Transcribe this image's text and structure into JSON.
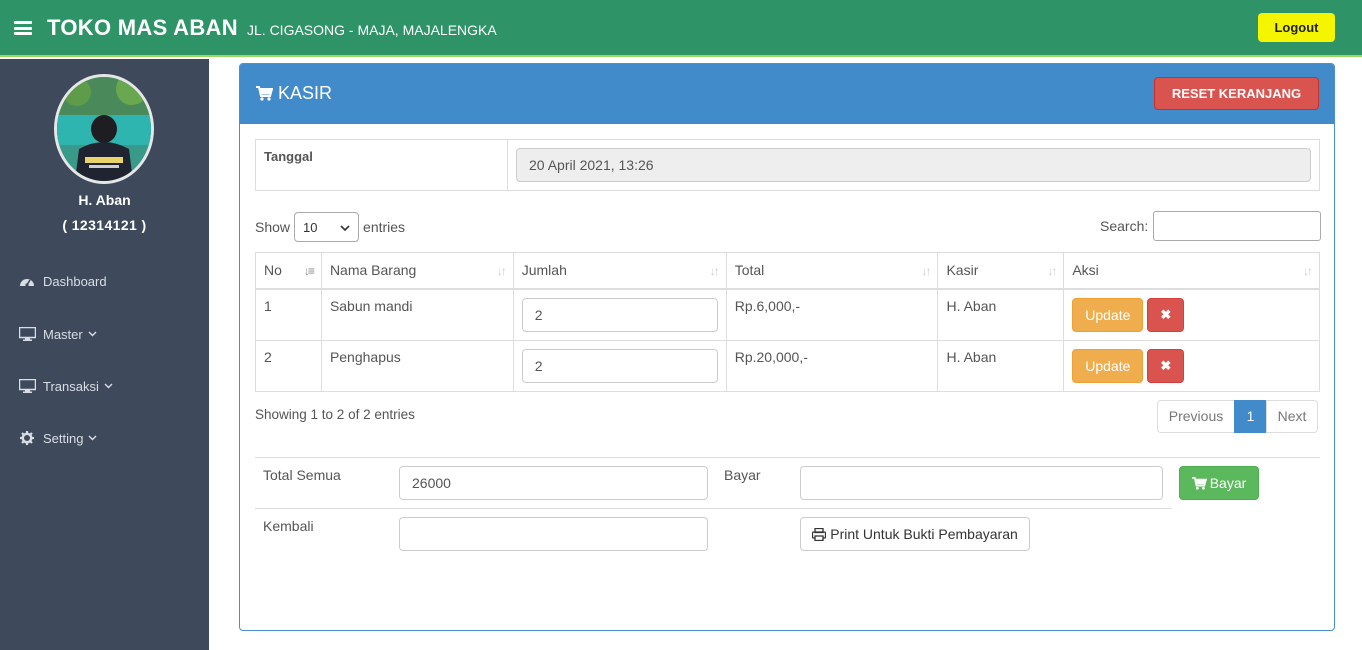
{
  "header": {
    "brand": "TOKO MAS ABAN",
    "address": "JL. CIGASONG - MAJA, MAJALENGKA",
    "logout_label": "Logout"
  },
  "sidebar": {
    "user_name": "H. Aban",
    "user_id": "( 12314121 )",
    "items": [
      {
        "label": "Dashboard",
        "icon": "dashboard-icon"
      },
      {
        "label": "Master",
        "icon": "monitor-icon"
      },
      {
        "label": "Transaksi",
        "icon": "monitor-icon"
      },
      {
        "label": "Setting",
        "icon": "gear-icon"
      }
    ]
  },
  "panel": {
    "title": "KASIR",
    "reset_label": "RESET KERANJANG"
  },
  "date_row": {
    "label": "Tanggal",
    "value": "20 April 2021, 13:26"
  },
  "table_controls": {
    "show_label": "Show",
    "entries_value": "10",
    "entries_label": "entries",
    "search_label": "Search:"
  },
  "table": {
    "headers": [
      "No",
      "Nama Barang",
      "Jumlah",
      "Total",
      "Kasir",
      "Aksi"
    ],
    "rows": [
      {
        "no": "1",
        "nama": "Sabun mandi",
        "jumlah": "2",
        "total": "Rp.6,000,-",
        "kasir": "H. Aban",
        "update_label": "Update",
        "delete_label": "✖"
      },
      {
        "no": "2",
        "nama": "Penghapus",
        "jumlah": "2",
        "total": "Rp.20,000,-",
        "kasir": "H. Aban",
        "update_label": "Update",
        "delete_label": "✖"
      }
    ]
  },
  "table_footer": {
    "info": "Showing 1 to 2 of 2 entries",
    "previous": "Previous",
    "current_page": "1",
    "next": "Next"
  },
  "payment": {
    "total_label": "Total Semua",
    "total_value": "26000",
    "bayar_label": "Bayar",
    "bayar_value": "",
    "bayar_button": "Bayar",
    "kembali_label": "Kembali",
    "kembali_value": "",
    "print_button": "Print Untuk Bukti Pembayaran"
  },
  "colors": {
    "topbar": "#2e9468",
    "sidebar": "#3e4a5c",
    "panel_header": "#428bca",
    "logout": "#f5f500",
    "danger": "#d9534f",
    "warning": "#f0ad4e",
    "success": "#5cb85c"
  }
}
